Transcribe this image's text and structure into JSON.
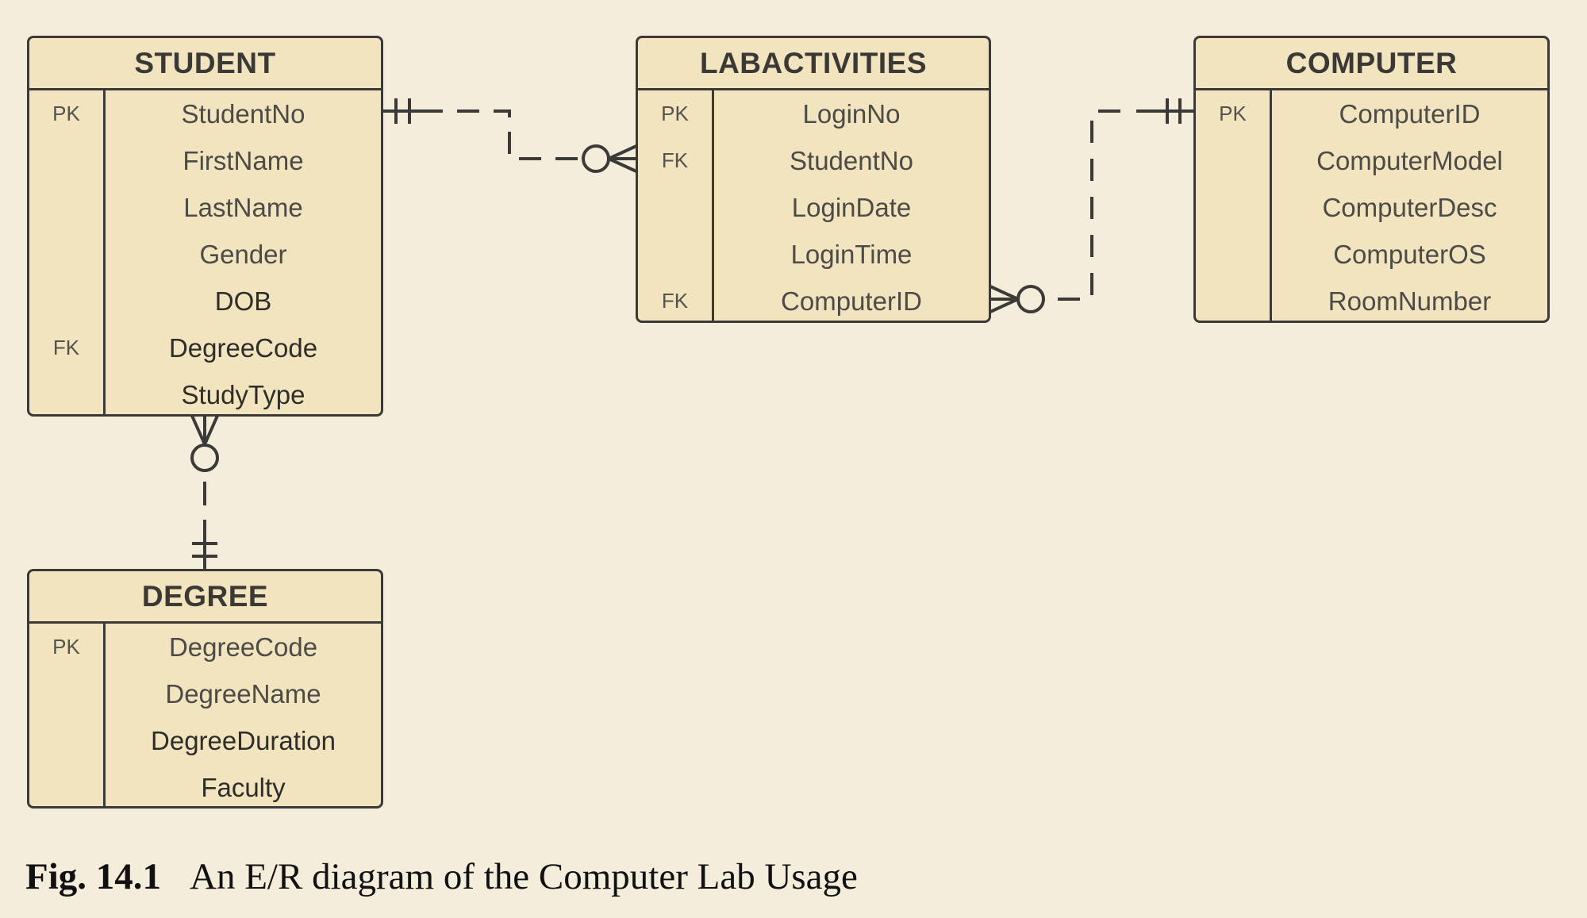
{
  "entities": {
    "student": {
      "name": "STUDENT",
      "attributes": [
        {
          "key": "PK",
          "name": "StudentNo"
        },
        {
          "key": "",
          "name": "FirstName"
        },
        {
          "key": "",
          "name": "LastName"
        },
        {
          "key": "",
          "name": "Gender"
        },
        {
          "key": "",
          "name": "DOB"
        },
        {
          "key": "FK",
          "name": "DegreeCode"
        },
        {
          "key": "",
          "name": "StudyType"
        }
      ]
    },
    "labactivities": {
      "name": "LABACTIVITIES",
      "attributes": [
        {
          "key": "PK",
          "name": "LoginNo"
        },
        {
          "key": "FK",
          "name": "StudentNo"
        },
        {
          "key": "",
          "name": "LoginDate"
        },
        {
          "key": "",
          "name": "LoginTime"
        },
        {
          "key": "FK",
          "name": "ComputerID"
        }
      ]
    },
    "computer": {
      "name": "COMPUTER",
      "attributes": [
        {
          "key": "PK",
          "name": "ComputerID"
        },
        {
          "key": "",
          "name": "ComputerModel"
        },
        {
          "key": "",
          "name": "ComputerDesc"
        },
        {
          "key": "",
          "name": "ComputerOS"
        },
        {
          "key": "",
          "name": "RoomNumber"
        }
      ]
    },
    "degree": {
      "name": "DEGREE",
      "attributes": [
        {
          "key": "PK",
          "name": "DegreeCode"
        },
        {
          "key": "",
          "name": "DegreeName"
        },
        {
          "key": "",
          "name": "DegreeDuration"
        },
        {
          "key": "",
          "name": "Faculty"
        }
      ]
    }
  },
  "relationships": [
    {
      "from": "STUDENT",
      "from_cardinality": "one-and-only-one",
      "to": "LABACTIVITIES",
      "to_cardinality": "zero-or-many",
      "style": "dashed"
    },
    {
      "from": "COMPUTER",
      "from_cardinality": "one-and-only-one",
      "to": "LABACTIVITIES",
      "to_cardinality": "zero-or-many",
      "style": "dashed"
    },
    {
      "from": "DEGREE",
      "from_cardinality": "one-and-only-one",
      "to": "STUDENT",
      "to_cardinality": "zero-or-many",
      "style": "dashed"
    }
  ],
  "caption": {
    "label": "Fig. 14.1",
    "text": "An E/R diagram of the Computer Lab Usage"
  },
  "colors": {
    "background": "#f4eddb",
    "entity_fill": "#f2e4bf",
    "line": "#3b3a36"
  }
}
